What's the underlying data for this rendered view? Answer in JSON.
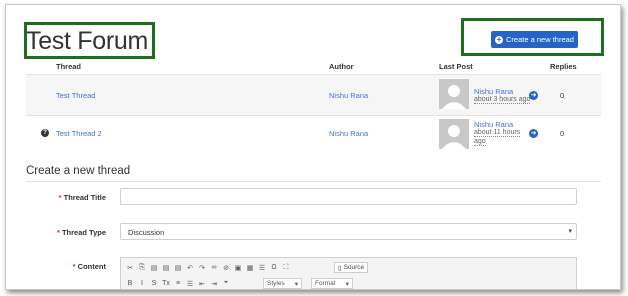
{
  "page": {
    "title": "Test Forum",
    "create_button_label": "Create a new thread"
  },
  "table": {
    "headers": [
      "Thread",
      "Author",
      "Last Post",
      "Replies"
    ],
    "rows": [
      {
        "thread": "Test Thread",
        "author": "Nishu Rana",
        "last_post_user": "Nishu Rana",
        "last_post_time": "about 3 hours ago",
        "replies": "0",
        "has_question_icon": false
      },
      {
        "thread": "Test Thread 2",
        "author": "Nishu Rana",
        "last_post_user": "Nishu Rana",
        "last_post_time_line1": "about 11 hours",
        "last_post_time_line2": "ago",
        "replies": "0",
        "has_question_icon": true
      }
    ]
  },
  "form": {
    "section_title": "Create a new thread",
    "title_label": "Thread Title",
    "type_label": "Thread Type",
    "type_value": "Discussion",
    "content_label": "Content",
    "required_mark": "*"
  },
  "editor": {
    "toolbar_row1": [
      {
        "icon": "cut-icon",
        "glyph": "✂"
      },
      {
        "icon": "copy-icon",
        "glyph": "⎘"
      },
      {
        "icon": "paste-icon",
        "glyph": "▤"
      },
      {
        "icon": "paste-text-icon",
        "glyph": "▤"
      },
      {
        "icon": "paste-word-icon",
        "glyph": "▤"
      },
      {
        "icon": "undo-icon",
        "glyph": "↶"
      },
      {
        "icon": "redo-icon",
        "glyph": "↷"
      },
      {
        "icon": "link-icon",
        "glyph": "∞"
      },
      {
        "icon": "unlink-icon",
        "glyph": "⊘"
      },
      {
        "icon": "image-icon",
        "glyph": "▣"
      },
      {
        "icon": "table-icon",
        "glyph": "▦"
      },
      {
        "icon": "horizontal-rule-icon",
        "glyph": "☰"
      },
      {
        "icon": "special-char-icon",
        "glyph": "Ω"
      },
      {
        "icon": "maximize-icon",
        "glyph": "⛶"
      }
    ],
    "source_label": "Source",
    "toolbar_row2": [
      {
        "icon": "bold-icon",
        "glyph": "B"
      },
      {
        "icon": "italic-icon",
        "glyph": "I"
      },
      {
        "icon": "strikethrough-icon",
        "glyph": "S"
      },
      {
        "icon": "remove-format-icon",
        "glyph": "Tx"
      },
      {
        "icon": "numbered-list-icon",
        "glyph": "≡"
      },
      {
        "icon": "bulleted-list-icon",
        "glyph": "☰"
      },
      {
        "icon": "outdent-icon",
        "glyph": "⇤"
      },
      {
        "icon": "indent-icon",
        "glyph": "⇥"
      },
      {
        "icon": "blockquote-icon",
        "glyph": "❞"
      }
    ],
    "styles_label": "Styles",
    "format_label": "Format"
  },
  "colors": {
    "accent": "#2563c7",
    "link": "#4a6fd4",
    "highlight_box": "#1e6e1e"
  }
}
